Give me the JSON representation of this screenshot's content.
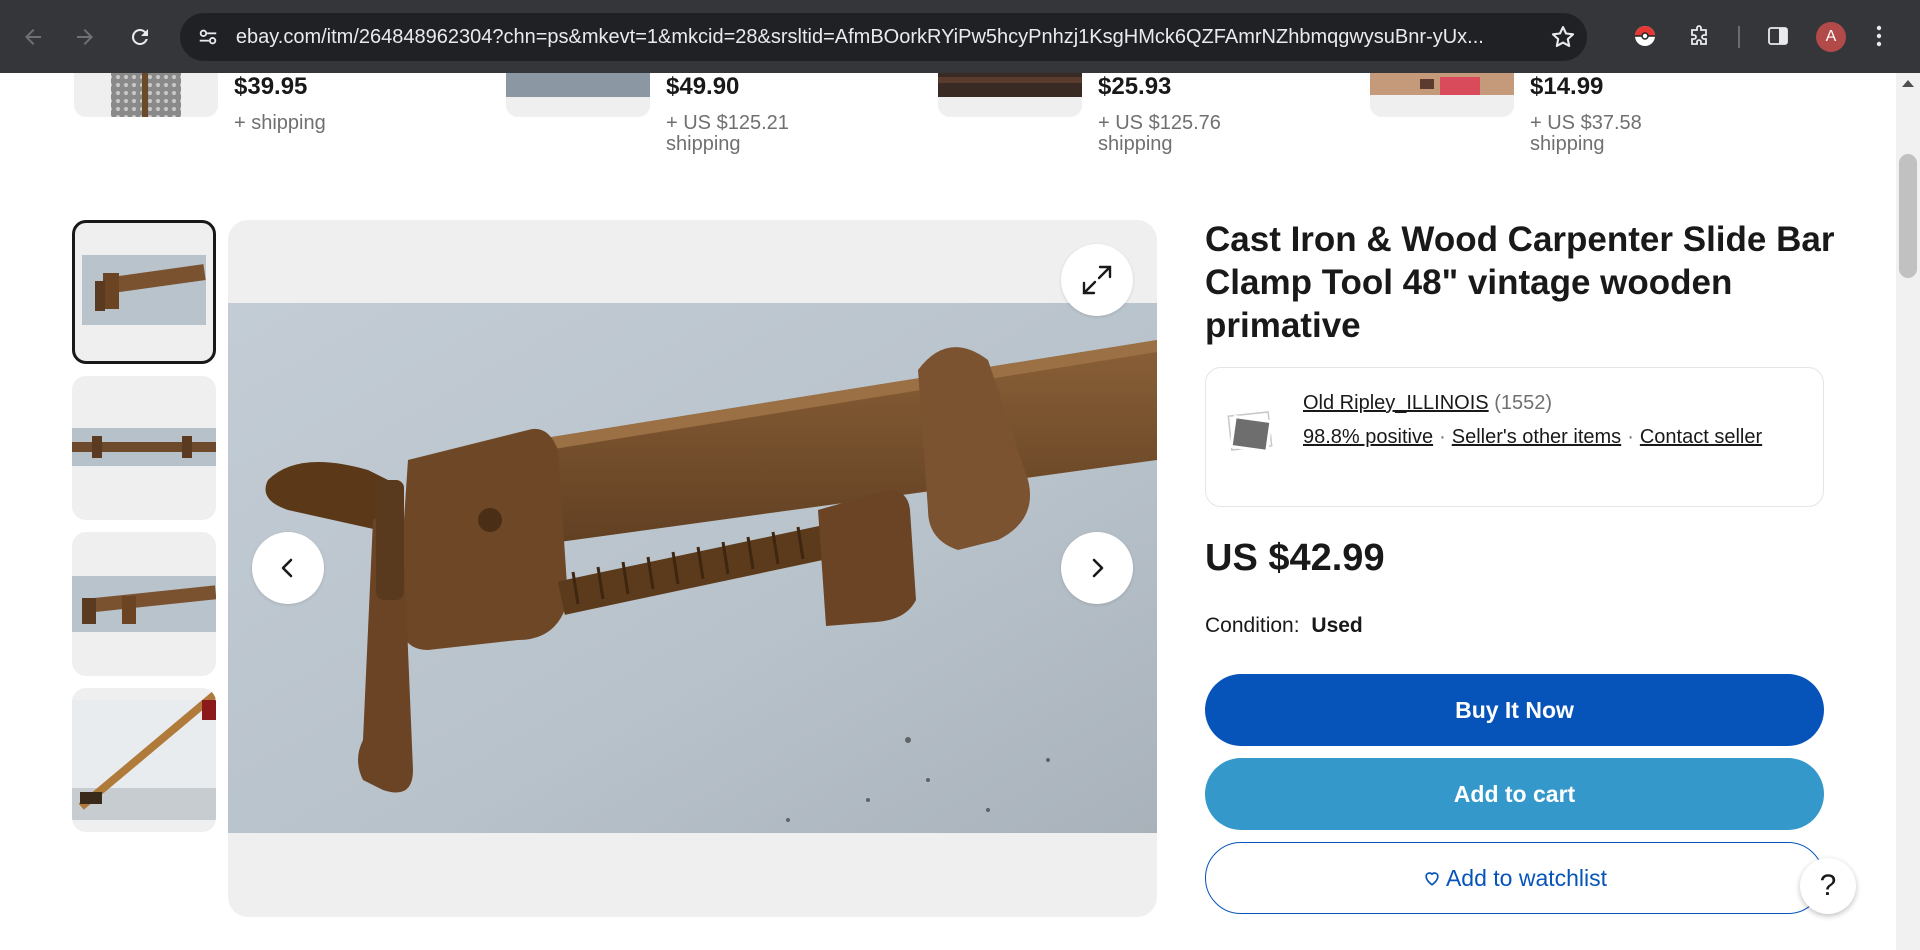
{
  "browser": {
    "url": "ebay.com/itm/264848962304?chn=ps&mkevt=1&mkcid=28&srsltid=AfmBOorkRYiPw5hcyPnhzj1KsgHMck6QZFAmrNZhbmqgwysuBnr-yUx...",
    "profile_initial": "A",
    "icons": [
      "back-icon",
      "forward-icon",
      "reload-icon",
      "site-settings-icon",
      "bookmark-star-icon",
      "pokeball-extension-icon",
      "extensions-puzzle-icon",
      "side-panel-icon",
      "profile-avatar",
      "kebab-menu-icon"
    ]
  },
  "similar_items": [
    {
      "price": "$39.95",
      "shipping": "+ shipping"
    },
    {
      "price": "$49.90",
      "shipping": "+ US $125.21 shipping"
    },
    {
      "price": "$25.93",
      "shipping": "+ US $125.76 shipping"
    },
    {
      "price": "$14.99",
      "shipping": "+ US $37.58 shipping"
    }
  ],
  "gallery": {
    "thumbnail_count": 4,
    "selected_index": 0,
    "icons": [
      "expand-icon",
      "chevron-left-icon",
      "chevron-right-icon"
    ]
  },
  "listing": {
    "title": "Cast Iron & Wood Carpenter Slide Bar Clamp Tool 48\" vintage wooden primative",
    "seller": {
      "name": "Old Ripley_ILLINOIS",
      "feedback_count": "(1552)",
      "positive": "98.8% positive",
      "other_items": "Seller's other items",
      "contact": "Contact seller"
    },
    "price": "US $42.99",
    "condition_label": "Condition:",
    "condition_value": "Used",
    "buy_now": "Buy It Now",
    "add_to_cart": "Add to cart",
    "add_to_watchlist": "Add to watchlist"
  },
  "help_label": "?",
  "colors": {
    "chrome_bg": "#35363a",
    "omnibox_bg": "#202124",
    "buy_now": "#0654ba",
    "add_to_cart": "#3498ca",
    "text": "#191919",
    "muted": "#707070"
  }
}
